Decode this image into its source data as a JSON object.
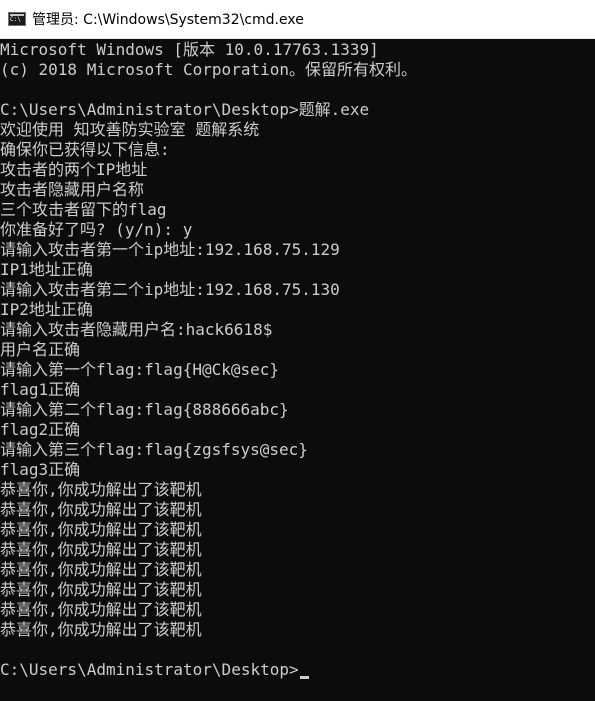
{
  "window": {
    "title": "管理员: C:\\Windows\\System32\\cmd.exe",
    "icon": "cmd-console-icon"
  },
  "console": {
    "lines": [
      "Microsoft Windows [版本 10.0.17763.1339]",
      "(c) 2018 Microsoft Corporation。保留所有权利。",
      "",
      "C:\\Users\\Administrator\\Desktop>题解.exe",
      "欢迎使用 知攻善防实验室 题解系统",
      "确保你已获得以下信息:",
      "攻击者的两个IP地址",
      "攻击者隐藏用户名称",
      "三个攻击者留下的flag",
      "你准备好了吗? (y/n): y",
      "请输入攻击者第一个ip地址:192.168.75.129",
      "IP1地址正确",
      "请输入攻击者第二个ip地址:192.168.75.130",
      "IP2地址正确",
      "请输入攻击者隐藏用户名:hack6618$",
      "用户名正确",
      "请输入第一个flag:flag{H@Ck@sec}",
      "flag1正确",
      "请输入第二个flag:flag{888666abc}",
      "flag2正确",
      "请输入第三个flag:flag{zgsfsys@sec}",
      "flag3正确",
      "恭喜你,你成功解出了该靶机",
      "恭喜你,你成功解出了该靶机",
      "恭喜你,你成功解出了该靶机",
      "恭喜你,你成功解出了该靶机",
      "恭喜你,你成功解出了该靶机",
      "恭喜你,你成功解出了该靶机",
      "恭喜你,你成功解出了该靶机",
      "恭喜你,你成功解出了该靶机",
      ""
    ],
    "prompt": "C:\\Users\\Administrator\\Desktop>"
  },
  "colors": {
    "console_background": "#0c0c0c",
    "console_text": "#cccccc",
    "titlebar_background": "#ffffff"
  }
}
